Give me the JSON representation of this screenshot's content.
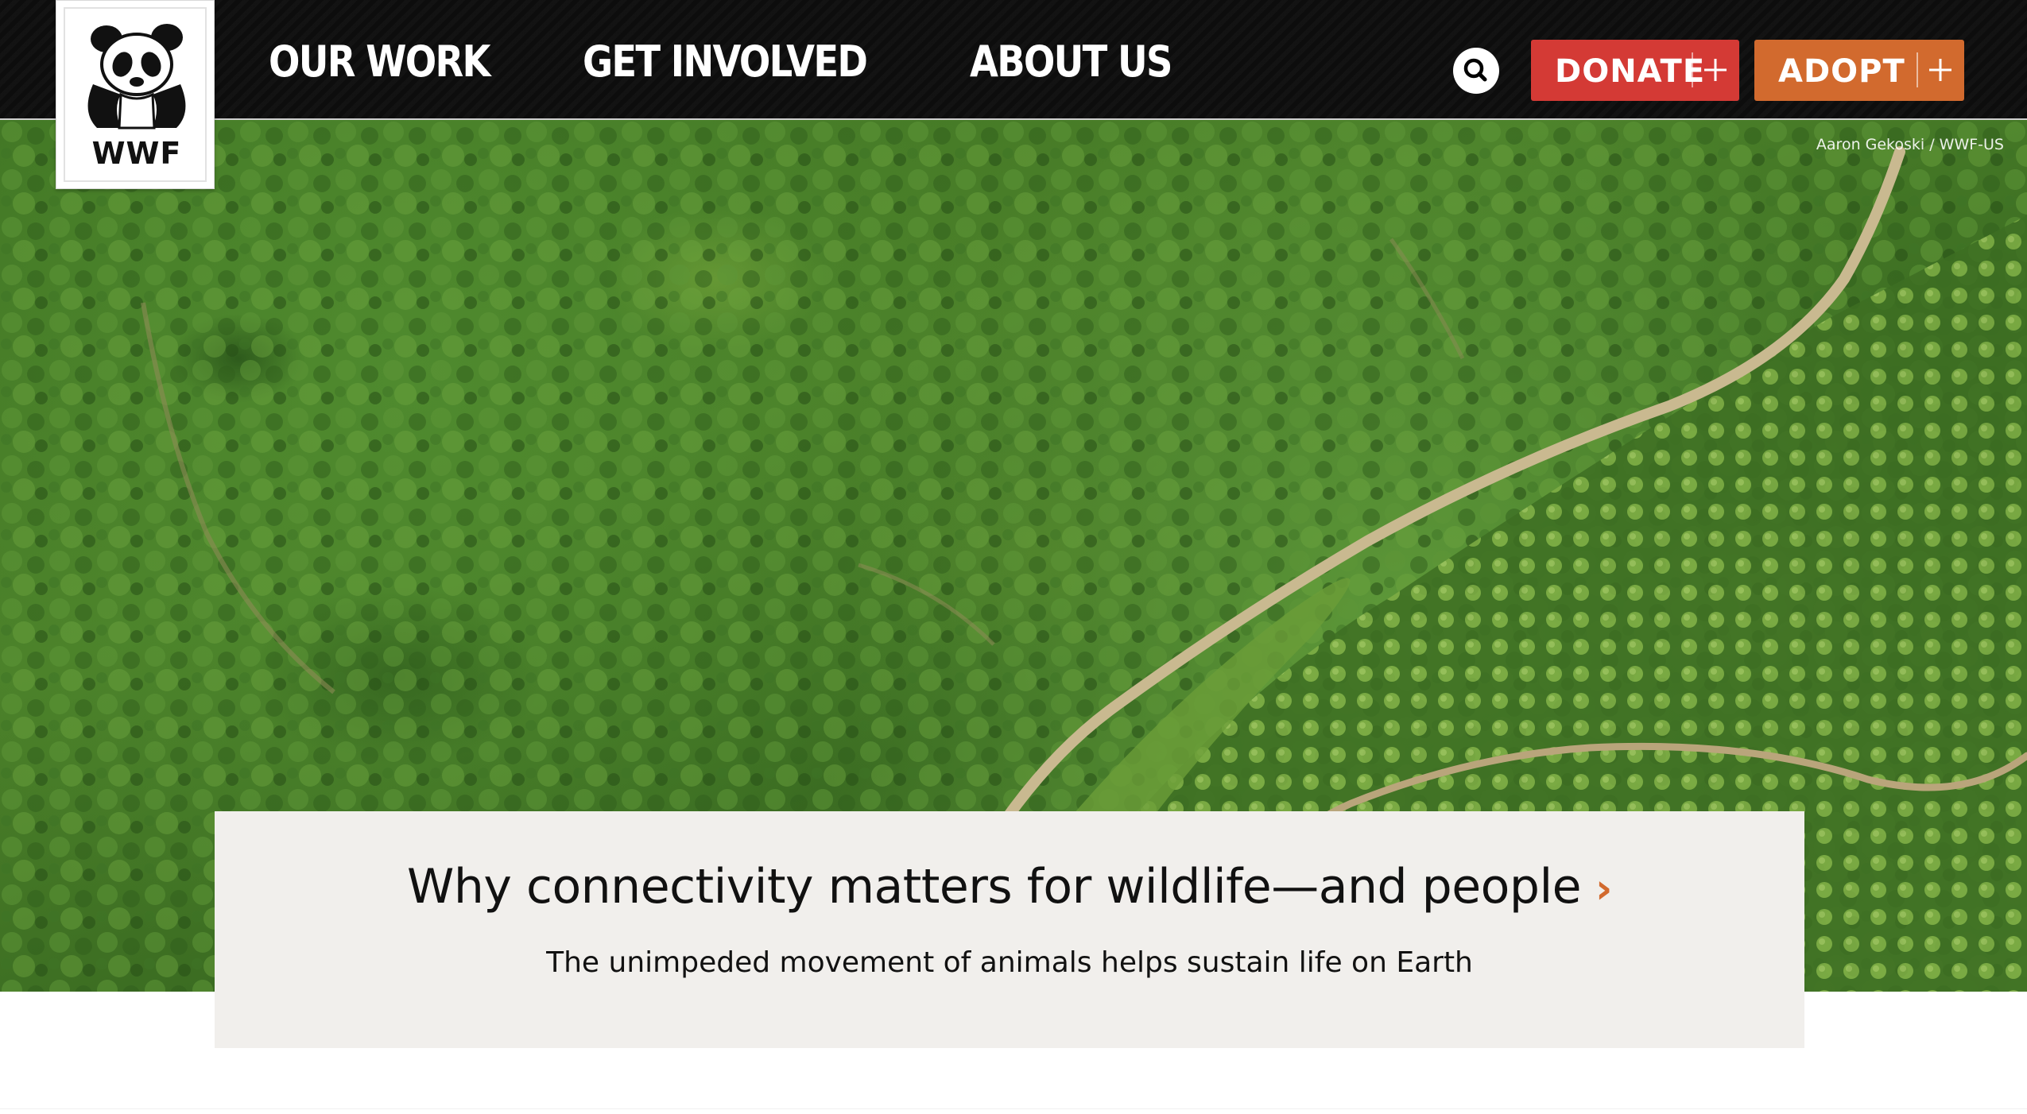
{
  "header": {
    "logo_text": "WWF",
    "nav": [
      {
        "label": "OUR WORK"
      },
      {
        "label": "GET INVOLVED"
      },
      {
        "label": "ABOUT US"
      }
    ],
    "search_icon": "search-icon",
    "donate_label": "DONATE",
    "adopt_label": "ADOPT",
    "colors": {
      "bar": "#0d0d0d",
      "donate": "#d43a35",
      "adopt": "#d26a2e"
    }
  },
  "hero": {
    "photo_credit": "Aaron Gekoski / WWF-US"
  },
  "feature": {
    "title": "Why connectivity matters for wildlife—and people",
    "chevron": "›",
    "subtitle": "The unimpeded movement of animals helps sustain life on Earth"
  }
}
